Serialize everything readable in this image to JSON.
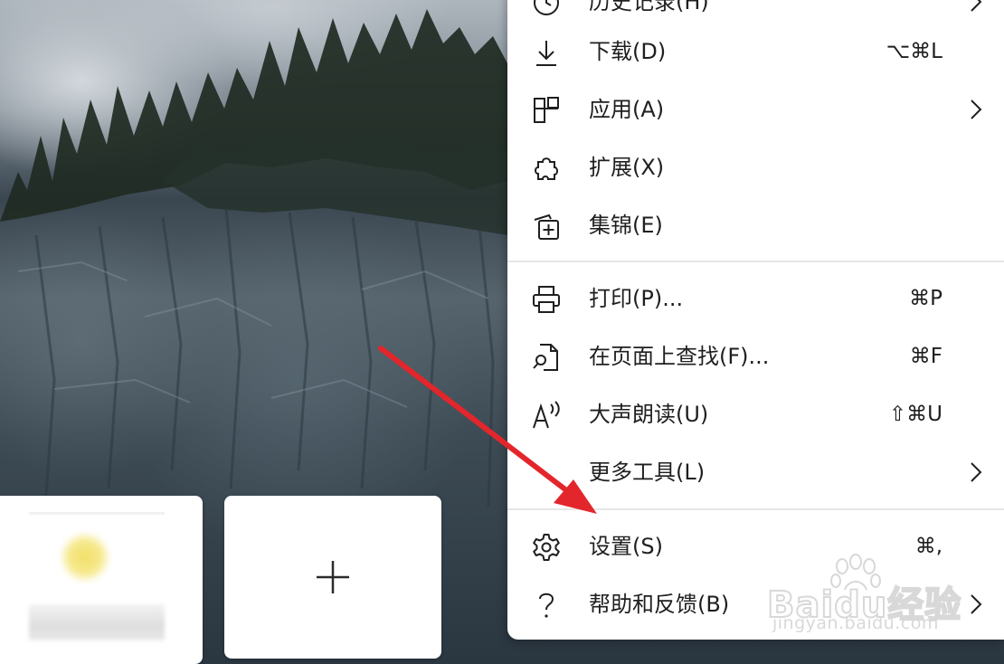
{
  "menu": {
    "items": [
      {
        "label": "历史记录(H)",
        "shortcut": "",
        "icon": "history-icon",
        "submenu": true
      },
      {
        "label": "下载(D)",
        "shortcut": "⌥⌘L",
        "icon": "download-icon",
        "submenu": false
      },
      {
        "label": "应用(A)",
        "shortcut": "",
        "icon": "apps-icon",
        "submenu": true
      },
      {
        "label": "扩展(X)",
        "shortcut": "",
        "icon": "extensions-icon",
        "submenu": false
      },
      {
        "label": "集锦(E)",
        "shortcut": "",
        "icon": "collections-icon",
        "submenu": false
      },
      {
        "label": "打印(P)...",
        "shortcut": "⌘P",
        "icon": "print-icon",
        "submenu": false
      },
      {
        "label": "在页面上查找(F)...",
        "shortcut": "⌘F",
        "icon": "find-on-page-icon",
        "submenu": false
      },
      {
        "label": "大声朗读(U)",
        "shortcut": "⇧⌘U",
        "icon": "read-aloud-icon",
        "submenu": false
      },
      {
        "label": "更多工具(L)",
        "shortcut": "",
        "icon": "",
        "submenu": true
      },
      {
        "label": "设置(S)",
        "shortcut": "⌘,",
        "icon": "settings-icon",
        "submenu": false
      },
      {
        "label": "帮助和反馈(B)",
        "shortcut": "",
        "icon": "help-icon",
        "submenu": true
      }
    ]
  },
  "tiles": {
    "add_tile_icon": "plus-icon",
    "site_tile_favicon": "yellow-circle-favicon"
  },
  "watermark": {
    "text": "Baidu经验",
    "subtext": "jingyan.baidu.com"
  },
  "colors": {
    "annotation_arrow": "#e3262b",
    "menu_background": "#ffffff",
    "menu_text": "#1f1f1f"
  }
}
